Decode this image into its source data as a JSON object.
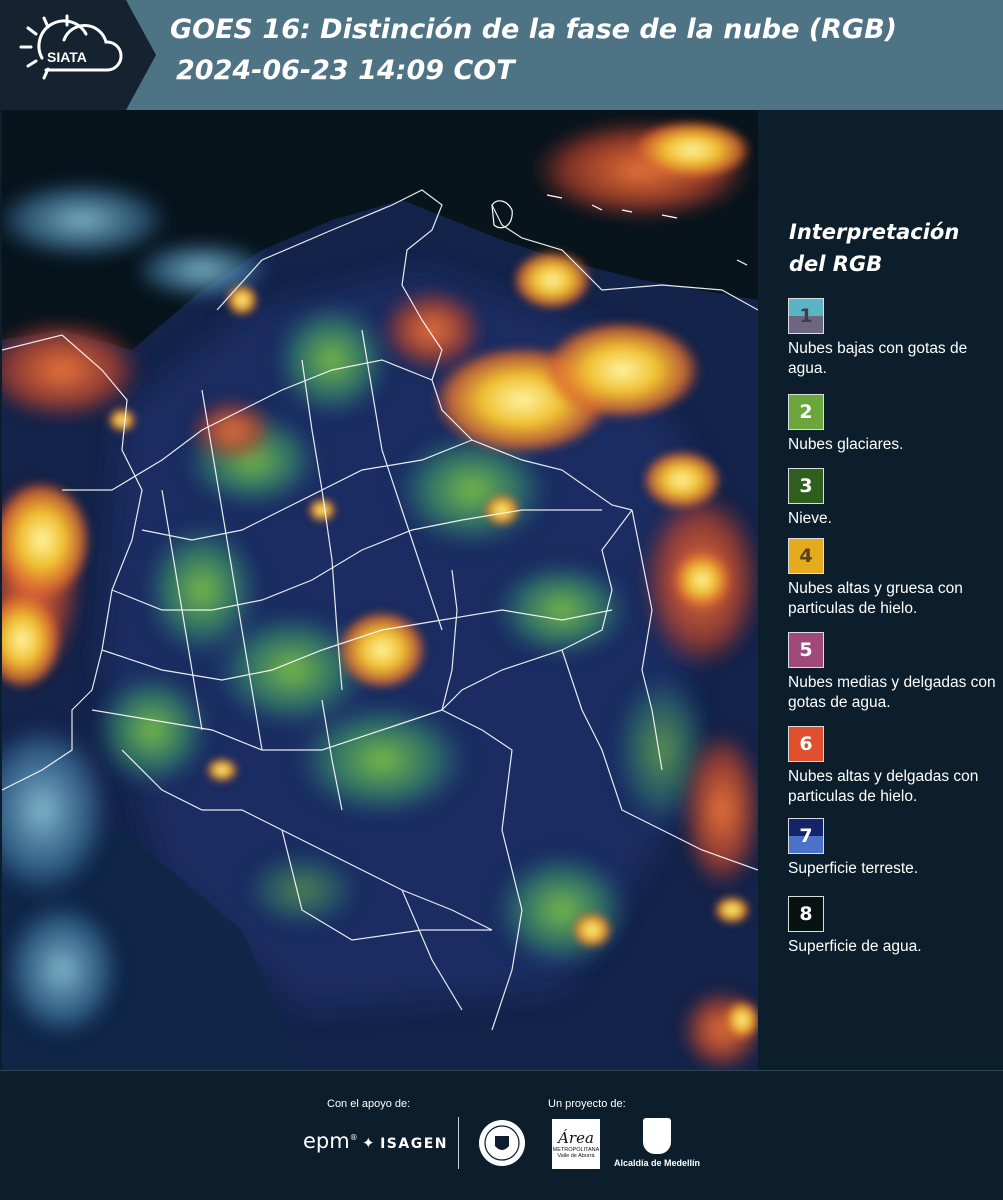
{
  "header": {
    "logo_text": "SIATA",
    "title_line1": "GOES 16: Distinción de la fase de la nube (RGB)",
    "title_line2": "2024-06-23 14:09 COT"
  },
  "legend": {
    "title": "Interpretación del RGB",
    "items": [
      {
        "number": "1",
        "label": "Nubes bajas con gotas de agua.",
        "color": "#5ab4c4",
        "color2": "#6e6680"
      },
      {
        "number": "2",
        "label": "Nubes glaciares.",
        "color": "#6aa63c"
      },
      {
        "number": "3",
        "label": "Nieve.",
        "color": "#2f5f1e"
      },
      {
        "number": "4",
        "label": "Nubes altas y gruesa con particulas de hielo.",
        "color": "#e5ab1e"
      },
      {
        "number": "5",
        "label": "Nubes medias y delgadas con gotas de agua.",
        "color": "#a04a7c"
      },
      {
        "number": "6",
        "label": "Nubes altas y delgadas con particulas de hielo.",
        "color": "#e0502e"
      },
      {
        "number": "7",
        "label": "Superficie terreste.",
        "color": "#13246a",
        "color2": "#4a72c8"
      },
      {
        "number": "8",
        "label": "Superficie de agua.",
        "color": "#061310"
      }
    ]
  },
  "footer": {
    "support_label": "Con el apoyo de:",
    "project_label": "Un proyecto de:",
    "epm": "epm",
    "isagen": "ISAGEN",
    "area_script": "Área",
    "area_line1": "METROPOLITANA",
    "area_line2": "Valle de Aburrá",
    "alcaldia": "Alcaldía de Medellín"
  }
}
